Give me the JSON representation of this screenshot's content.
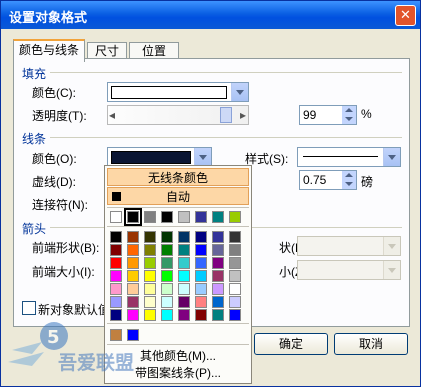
{
  "window": {
    "title": "设置对象格式"
  },
  "tabs": [
    "颜色与线条",
    "尺寸",
    "位置"
  ],
  "fill": {
    "section": "填充",
    "color_label": "颜色(C):",
    "transparency_label": "透明度(T):",
    "transparency_value": "99",
    "percent": "%",
    "transparency_left_arrow": "◂",
    "transparency_right_arrow": "▸"
  },
  "line": {
    "section": "线条",
    "color_label": "颜色(O):",
    "style_label": "样式(S):",
    "dash_label": "虚线(D):",
    "weight_value": "0.75",
    "weight_unit": "磅",
    "connector_label": "连接符(N):"
  },
  "arrows": {
    "section": "箭头",
    "begin_style_label": "前端形状(B):",
    "begin_size_label": "前端大小(I):",
    "end_style_label": "状(E):",
    "end_size_label": "小(Z):"
  },
  "default_checkbox_label": "新对象默认值",
  "buttons": {
    "ok": "确定",
    "cancel": "取消"
  },
  "color_menu": {
    "no_line": "无线条颜色",
    "auto": "自动",
    "more_colors": "其他颜色(M)...",
    "pattern_line": "带图案线条(P)...",
    "recent_colors": [
      "#ffffff",
      "#000000",
      "#808080",
      "#000000",
      "#c0c0c0",
      "#333399",
      "#008080",
      "#99cc00"
    ],
    "palette": [
      [
        "#000000",
        "#993300",
        "#333300",
        "#003300",
        "#003366",
        "#000080",
        "#333399",
        "#333333"
      ],
      [
        "#800000",
        "#ff6600",
        "#808000",
        "#008000",
        "#008080",
        "#0000ff",
        "#666699",
        "#808080"
      ],
      [
        "#ff0000",
        "#ff9900",
        "#99cc00",
        "#339966",
        "#33cccc",
        "#3366ff",
        "#800080",
        "#969696"
      ],
      [
        "#ff00ff",
        "#ffcc00",
        "#ffff00",
        "#00ff00",
        "#00ffff",
        "#00ccff",
        "#993366",
        "#c0c0c0"
      ],
      [
        "#ff99cc",
        "#ffcc99",
        "#ffff99",
        "#ccffcc",
        "#ccffff",
        "#99ccff",
        "#cc99ff",
        "#ffffff"
      ],
      [
        "#9999ff",
        "#993366",
        "#ffffcc",
        "#ccffff",
        "#660066",
        "#ff8080",
        "#0066cc",
        "#ccccff"
      ],
      [
        "#000080",
        "#ff00ff",
        "#ffff00",
        "#00ffff",
        "#800080",
        "#800000",
        "#008080",
        "#0000ff"
      ]
    ],
    "custom_colors": [
      "#c08040",
      "#0000ff"
    ]
  },
  "watermark": {
    "text": "吾爱联盟"
  },
  "colors": {
    "accent": "#0a5fe3",
    "section_text": "#003399",
    "highlight": "#fdd7a6"
  }
}
